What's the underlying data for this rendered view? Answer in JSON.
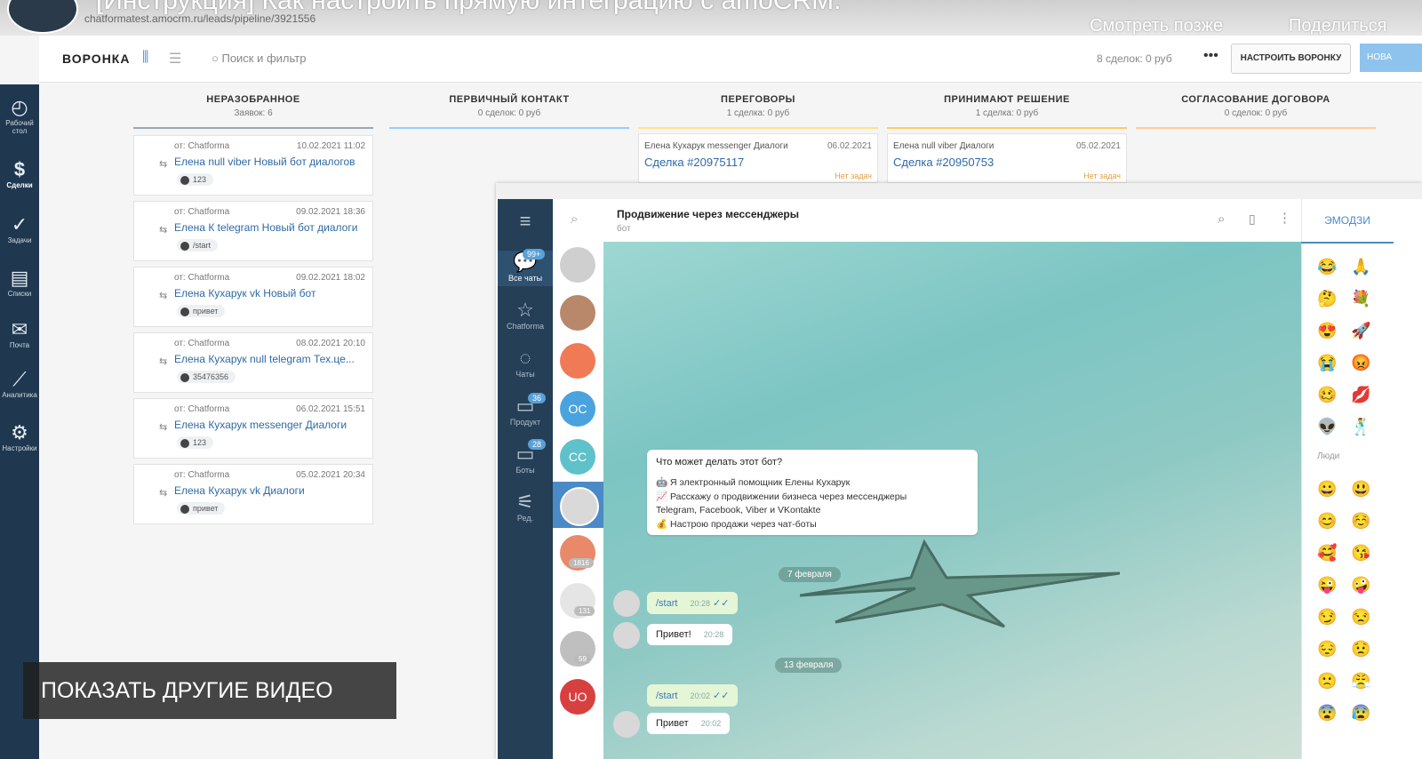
{
  "video": {
    "title": "[Инструкция] Как настроить прямую интеграцию с amoCRM.",
    "watch_later": "Смотреть позже",
    "share": "Поделиться",
    "show_other_videos": "ПОКАЗАТЬ ДРУГИЕ ВИДЕО"
  },
  "browser": {
    "url": "chatformatest.amocrm.ru/leads/pipeline/3921556"
  },
  "nav": {
    "items": [
      {
        "label": "Рабочий стол",
        "icon": "dashboard-icon"
      },
      {
        "label": "Сделки",
        "icon": "deals-icon"
      },
      {
        "label": "Задачи",
        "icon": "tasks-icon"
      },
      {
        "label": "Списки",
        "icon": "lists-icon"
      },
      {
        "label": "Почта",
        "icon": "mail-icon"
      },
      {
        "label": "Аналитика",
        "icon": "analytics-icon"
      },
      {
        "label": "Настройки",
        "icon": "settings-icon"
      }
    ]
  },
  "header": {
    "title": "ВОРОНКА",
    "search_placeholder": "Поиск и фильтр",
    "deals_count": "8 сделок: 0 руб",
    "more": "•••",
    "setup_button": "НАСТРОИТЬ ВОРОНКУ",
    "add_button": "НОВА"
  },
  "columns": [
    {
      "title": "НЕРАЗОБРАННОЕ",
      "subtitle": "Заявок: 6",
      "color": "#9aa7b4"
    },
    {
      "title": "ПЕРВИЧНЫЙ КОНТАКТ",
      "subtitle": "0 сделок: 0 руб",
      "color": "#99ccff"
    },
    {
      "title": "ПЕРЕГОВОРЫ",
      "subtitle": "1 сделка: 0 руб",
      "color": "#ffe28a"
    },
    {
      "title": "ПРИНИМАЮТ РЕШЕНИЕ",
      "subtitle": "1 сделка: 0 руб",
      "color": "#ffcc66"
    },
    {
      "title": "СОГЛАСОВАНИЕ ДОГОВОРА",
      "subtitle": "0 сделок: 0 руб",
      "color": "#ffcc99"
    }
  ],
  "unsorted": [
    {
      "from": "от: Chatforma",
      "date": "10.02.2021 11:02",
      "name": "Елена null viber Новый бот диалогов",
      "tag": "123"
    },
    {
      "from": "от: Chatforma",
      "date": "09.02.2021 18:36",
      "name": "Елена К telegram Новый бот диалоги",
      "tag": "/start"
    },
    {
      "from": "от: Chatforma",
      "date": "09.02.2021 18:02",
      "name": "Елена Кухарук vk Новый бот",
      "tag": "привет"
    },
    {
      "from": "от: Chatforma",
      "date": "08.02.2021 20:10",
      "name": "Елена Кухарук null telegram Тех.це...",
      "tag": "35476356"
    },
    {
      "from": "от: Chatforma",
      "date": "06.02.2021 15:51",
      "name": "Елена Кухарук messenger Диалоги",
      "tag": "123"
    },
    {
      "from": "от: Chatforma",
      "date": "05.02.2021 20:34",
      "name": "Елена Кухарук vk Диалоги",
      "tag": "привет"
    }
  ],
  "deals": [
    {
      "source": "Елена Кухарук messenger Диалоги",
      "date": "06.02.2021",
      "deal": "Сделка #20975117",
      "no_task": "Нет задач"
    },
    {
      "source": "Елена null viber Диалоги",
      "date": "05.02.2021",
      "deal": "Сделка #20950753",
      "no_task": "Нет задач"
    }
  ],
  "telegram": {
    "nav": [
      {
        "label": "Все чаты",
        "badge": "99+"
      },
      {
        "label": "Chatforma",
        "badge": ""
      },
      {
        "label": "Чаты",
        "badge": ""
      },
      {
        "label": "Продукт",
        "badge": "36"
      },
      {
        "label": "Боты",
        "badge": "28"
      },
      {
        "label": "Ред.",
        "badge": ""
      }
    ],
    "avatars": [
      {
        "text": "",
        "color": "#cfcfcf"
      },
      {
        "text": "",
        "color": "#b9876a"
      },
      {
        "text": "",
        "color": "#f07a56"
      },
      {
        "text": "ОС",
        "color": "#4aa3df"
      },
      {
        "text": "CC",
        "color": "#5fc1c9"
      },
      {
        "text": "",
        "color": "#d9d9d9"
      },
      {
        "text": "",
        "color": "#e88a6a"
      },
      {
        "text": "",
        "color": "#e5e5e5"
      },
      {
        "text": "",
        "color": "#bfbfbf"
      },
      {
        "text": "UO",
        "color": "#d84040"
      }
    ],
    "avatar_counts": [
      "1816",
      "131",
      "59"
    ],
    "chat_title": "Продвижение через мессенджеры",
    "chat_subtitle": "бот",
    "bot_info": {
      "question": "Что может делать этот бот?",
      "lines": [
        "🤖 Я электронный помощник Елены Кухарук",
        "📈 Расскажу о продвижении бизнеса через мессенджеры",
        "Telegram, Facebook, Viber и VKontakte",
        "💰 Настрою продажи через чат-боты"
      ]
    },
    "dates": [
      "7 февраля",
      "13 февраля"
    ],
    "messages": [
      {
        "text": "/start",
        "time": "20:28",
        "dir": "out"
      },
      {
        "text": "Привет!",
        "time": "20:28",
        "dir": "in"
      },
      {
        "text": "/start",
        "time": "20:02",
        "dir": "out"
      },
      {
        "text": "Привет",
        "time": "20:02",
        "dir": "in"
      }
    ],
    "emoji_tab": "ЭМОДЗИ",
    "people_label": "Люди",
    "emojis": [
      "😂",
      "🙏",
      "🤔",
      "💐",
      "😍",
      "🚀",
      "😭",
      "😡",
      "🥴",
      "💋",
      "👽",
      "🕺",
      "😀",
      "😃",
      "😊",
      "☺️",
      "🥰",
      "😘",
      "😜",
      "🤪",
      "😏",
      "😒",
      "😔",
      "😟",
      "🙁",
      "😤",
      "😨",
      "😰"
    ]
  }
}
